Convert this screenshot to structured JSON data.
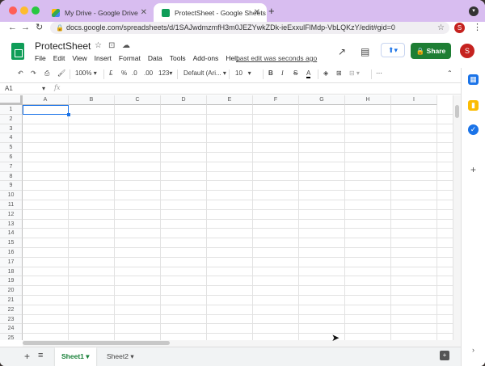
{
  "browser": {
    "tabs": [
      {
        "label": "My Drive - Google Drive",
        "active": false
      },
      {
        "label": "ProtectSheet - Google Sheets",
        "active": true
      }
    ],
    "url": "docs.google.com/spreadsheets/d/1SAJwdmzmfH3m0JEZYwkZDk-ieExxulFlMdp-VbLQKzY/edit#gid=0",
    "profile_initial": "S",
    "colors": {
      "titlebar": "#d8bdf0",
      "close": "#ff5f57",
      "minimize": "#febc2e",
      "zoom": "#28c840"
    }
  },
  "sheets_header": {
    "title": "ProtectSheet",
    "menu": [
      "File",
      "Edit",
      "View",
      "Insert",
      "Format",
      "Data",
      "Tools",
      "Add-ons",
      "Help"
    ],
    "last_edit": "Last edit was seconds ago",
    "share_label": "Share",
    "avatar_initial": "S",
    "share_color": "#1e7e34"
  },
  "toolbar": {
    "zoom": "100%",
    "currency": "£",
    "percent": "%",
    "dec_decrease": ".0",
    "dec_increase": ".00",
    "more_formats": "123",
    "font": "Default (Ari...",
    "font_size": "10",
    "bold": "B",
    "italic": "I",
    "strike": "S",
    "text_color": "A"
  },
  "formula_bar": {
    "cell_ref": "A1",
    "fx": "fx",
    "value": ""
  },
  "grid": {
    "columns": [
      "A",
      "B",
      "C",
      "D",
      "E",
      "F",
      "G",
      "H",
      "I"
    ],
    "rows": [
      "1",
      "2",
      "3",
      "4",
      "5",
      "6",
      "7",
      "8",
      "9",
      "10",
      "11",
      "12",
      "13",
      "14",
      "15",
      "16",
      "17",
      "18",
      "19",
      "20",
      "21",
      "22",
      "23",
      "24",
      "25"
    ],
    "selected_cell": "A1"
  },
  "sheet_tabs": [
    {
      "label": "Sheet1",
      "active": true
    },
    {
      "label": "Sheet2",
      "active": false
    }
  ]
}
